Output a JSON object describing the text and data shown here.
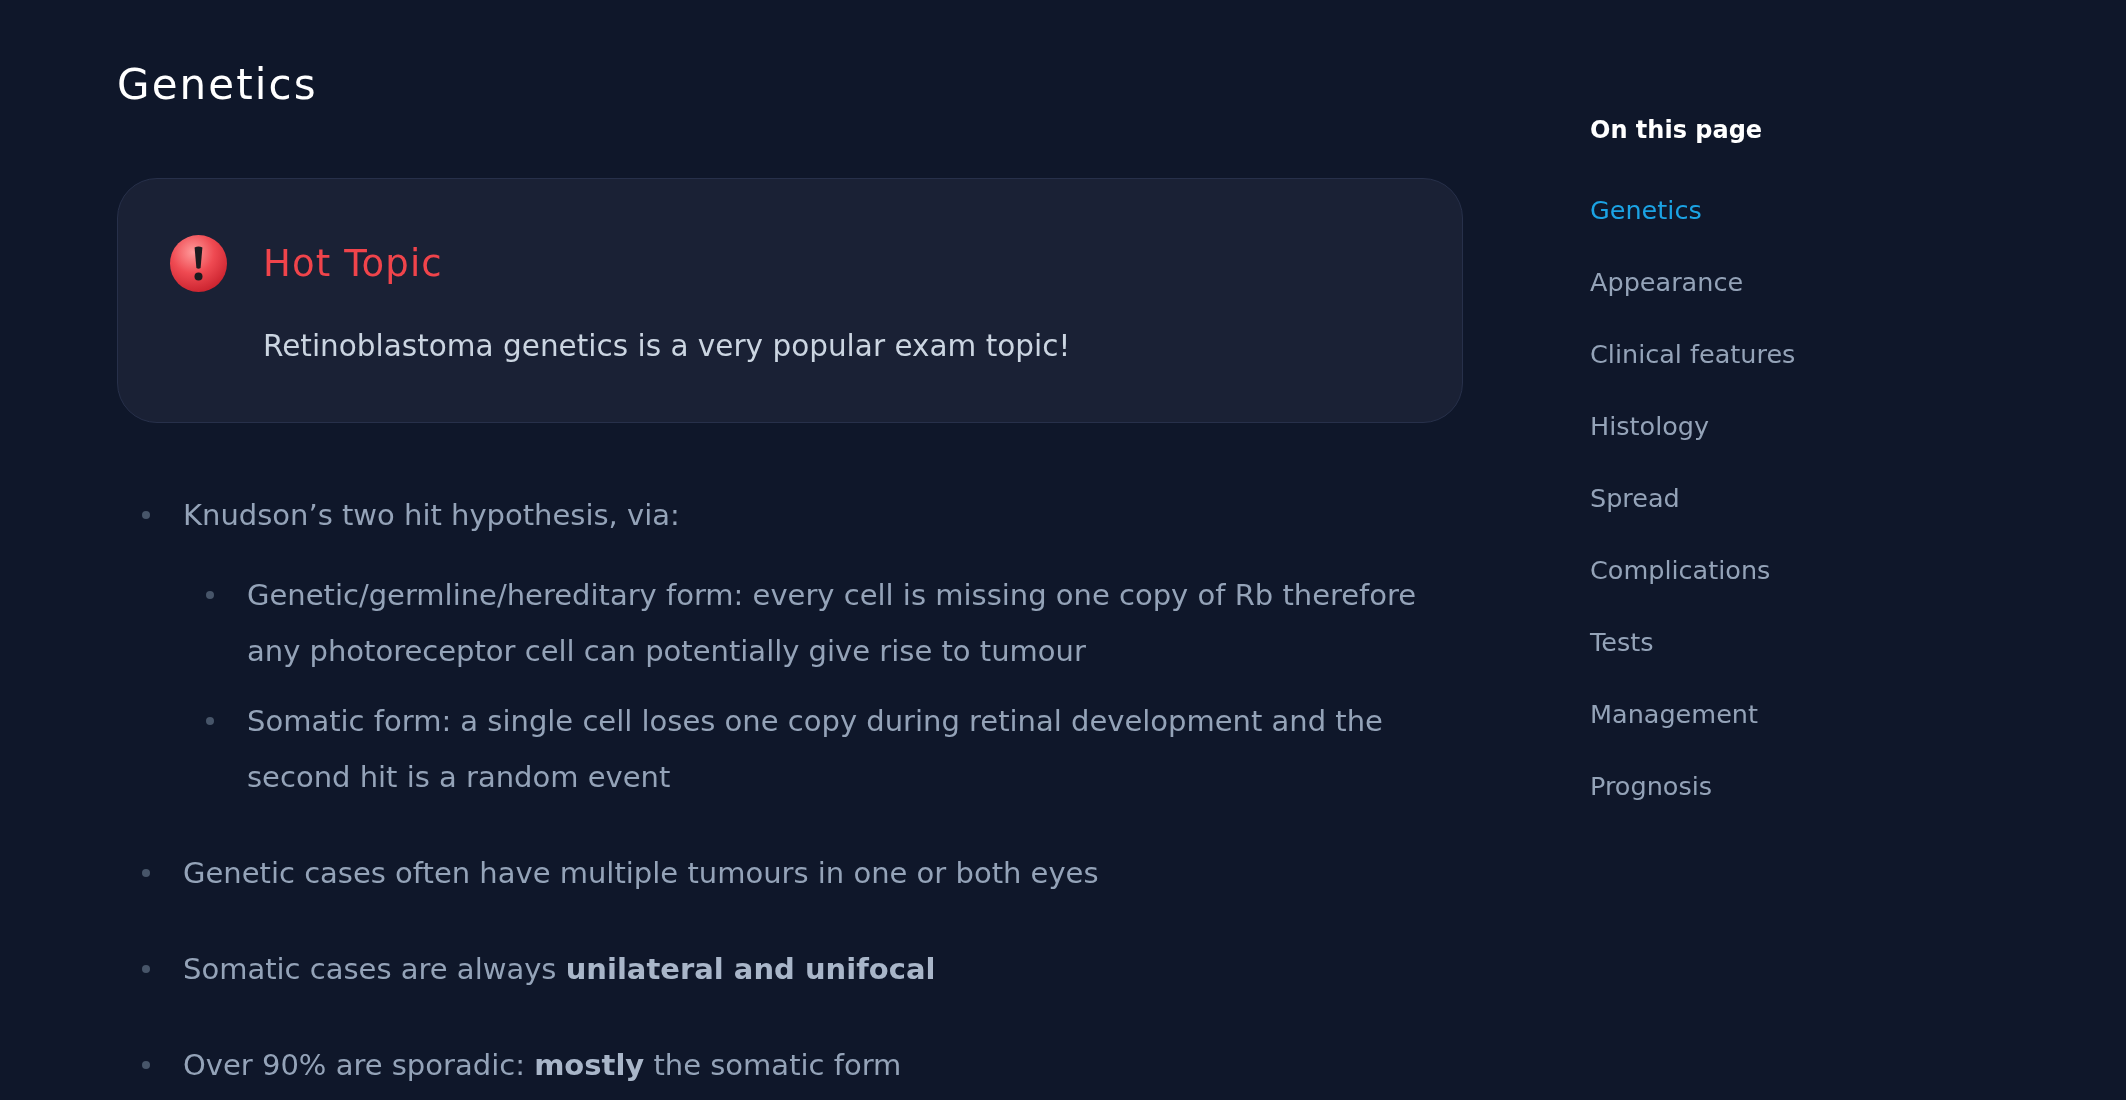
{
  "heading": "Genetics",
  "callout": {
    "title": "Hot Topic",
    "text": "Retinoblastoma genetics is a very popular exam topic!"
  },
  "bullets": [
    {
      "text": "Knudson’s two hit hypothesis, via:",
      "children": [
        {
          "text": "Genetic/germline/hereditary form: every cell is missing one copy of Rb therefore any photoreceptor cell can potentially give rise to tumour"
        },
        {
          "text": "Somatic form: a single cell loses one copy during retinal development and the second hit is a random event"
        }
      ]
    },
    {
      "text": "Genetic cases often have multiple tumours in one or both eyes"
    },
    {
      "text": "Somatic cases are always **unilateral and unifocal**"
    },
    {
      "text": "Over 90% are sporadic: **mostly** the somatic form"
    }
  ],
  "toc": {
    "title": "On this page",
    "items": [
      {
        "label": "Genetics",
        "selected": true
      },
      {
        "label": "Appearance",
        "selected": false
      },
      {
        "label": "Clinical features",
        "selected": false
      },
      {
        "label": "Histology",
        "selected": false
      },
      {
        "label": "Spread",
        "selected": false
      },
      {
        "label": "Complications",
        "selected": false
      },
      {
        "label": "Tests",
        "selected": false
      },
      {
        "label": "Management",
        "selected": false
      },
      {
        "label": "Prognosis",
        "selected": false
      }
    ]
  }
}
